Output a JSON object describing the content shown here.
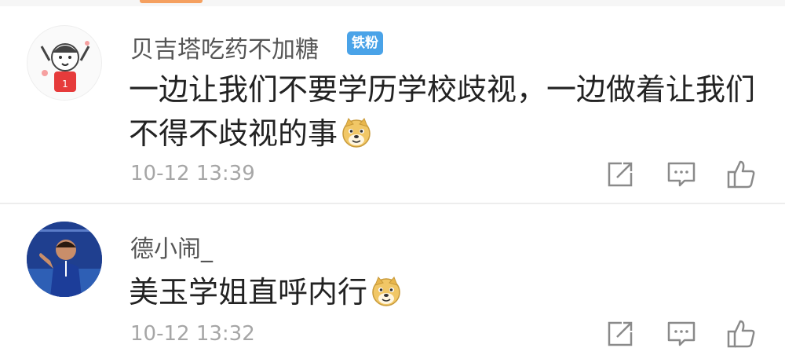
{
  "comments": [
    {
      "username": "贝吉塔吃药不加糖",
      "badge": "铁粉",
      "text": "一边让我们不要学历学校歧视，一边做着让我们不得不歧视的事",
      "time": "10-12 13:39"
    },
    {
      "username": "德小闹_",
      "text": "美玉学姐直呼内行",
      "time": "10-12 13:32"
    }
  ],
  "icons": {
    "share": "share-icon",
    "comment": "comment-icon",
    "like": "thumbs-up-icon",
    "emoji": "doge-emoji-icon"
  },
  "colors": {
    "badge": "#4aa3e8",
    "timestamp": "#a6a6a6",
    "icon": "#8a8a8a",
    "emoji": "#f1c766"
  }
}
